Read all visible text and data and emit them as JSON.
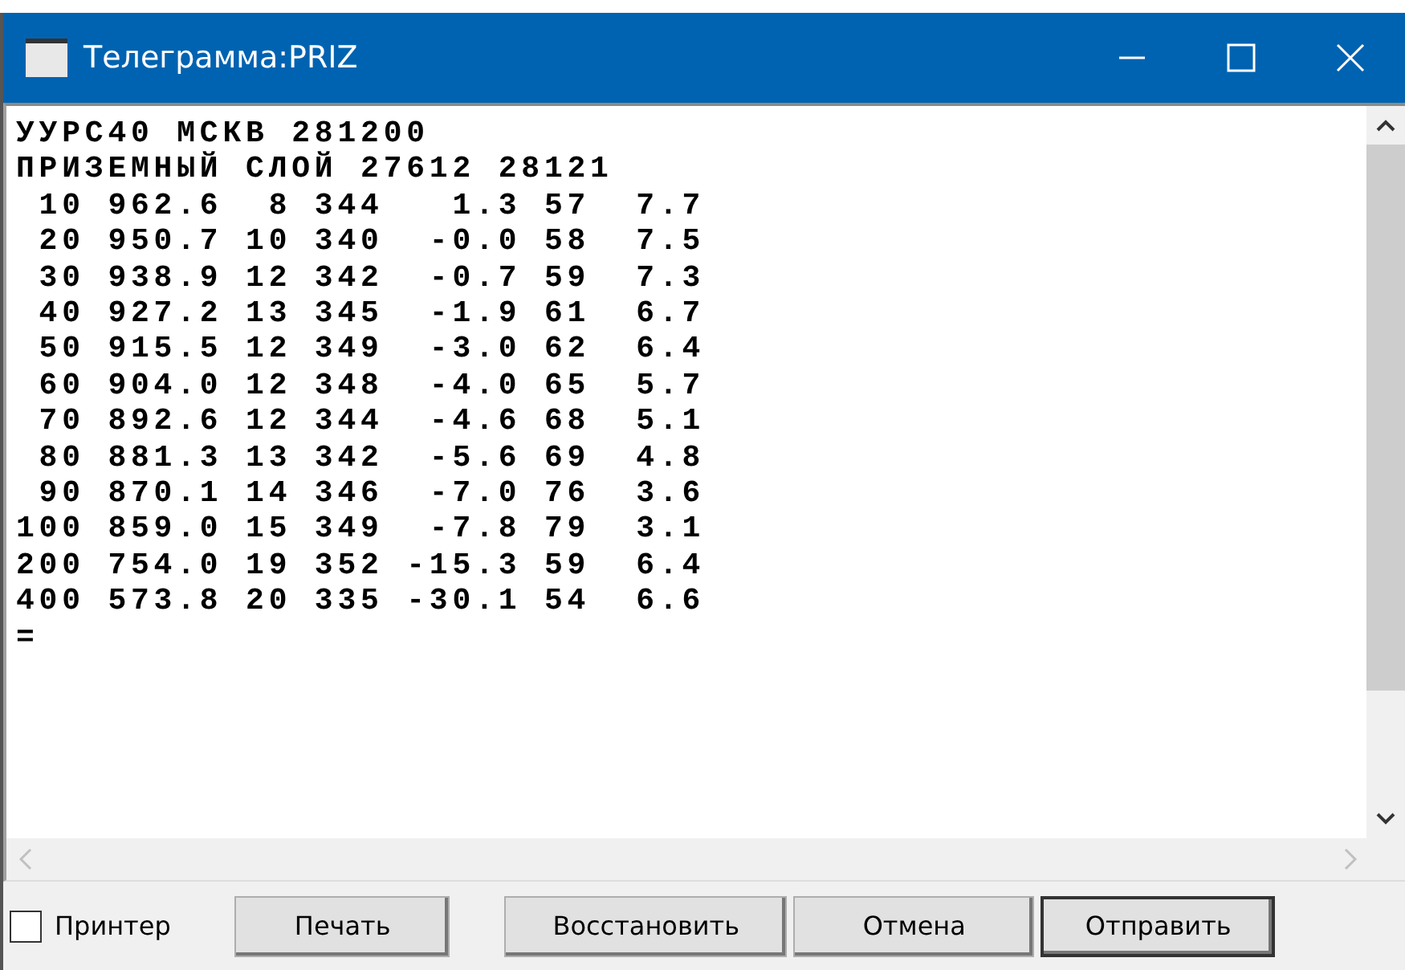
{
  "window": {
    "title": "Телеграмма:PRIZ"
  },
  "text_lines": [
    "УУРС40 МСКВ 281200",
    "ПРИЗЕМНЫЙ СЛОЙ 27612 28121",
    " 10 962.6  8 344   1.3 57  7.7",
    " 20 950.7 10 340  -0.0 58  7.5",
    " 30 938.9 12 342  -0.7 59  7.3",
    " 40 927.2 13 345  -1.9 61  6.7",
    " 50 915.5 12 349  -3.0 62  6.4",
    " 60 904.0 12 348  -4.0 65  5.7",
    " 70 892.6 12 344  -4.6 68  5.1",
    " 80 881.3 13 342  -5.6 69  4.8",
    " 90 870.1 14 346  -7.0 76  3.6",
    "100 859.0 15 349  -7.8 79  3.1",
    "200 754.0 19 352 -15.3 59  6.4",
    "400 573.8 20 335 -30.1 54  6.6",
    "="
  ],
  "printer": {
    "label": "Принтер",
    "checked": false
  },
  "buttons": [
    {
      "label": "Печать",
      "default": false
    },
    {
      "label": "Восстановить",
      "default": false
    },
    {
      "label": "Отмена",
      "default": false
    },
    {
      "label": "Отправить",
      "default": true
    }
  ]
}
